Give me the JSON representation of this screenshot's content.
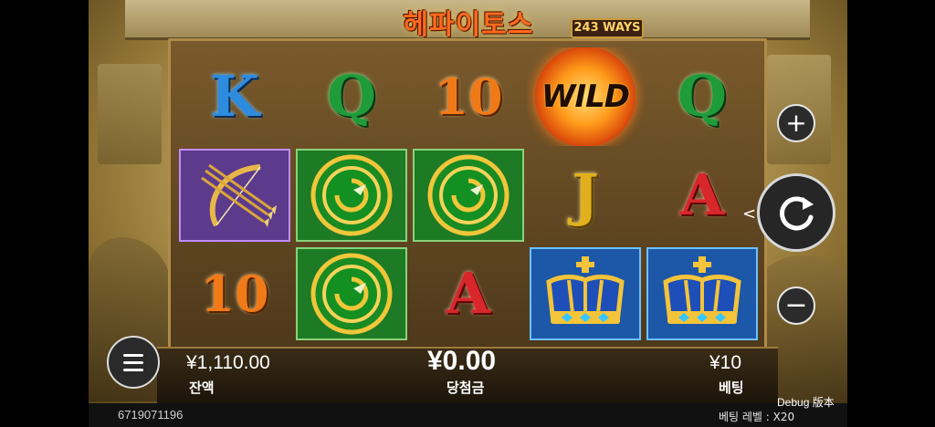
{
  "game": {
    "title": "헤파이토스",
    "ways_badge": "243 WAYS"
  },
  "reels": [
    [
      "K",
      "bow-arrows",
      "10"
    ],
    [
      "Q",
      "shield",
      "shield"
    ],
    [
      "10",
      "shield",
      "A"
    ],
    [
      "WILD",
      "J",
      "crown"
    ],
    [
      "Q",
      "A",
      "crown"
    ]
  ],
  "symbols": {
    "wild_text": "WILD",
    "K": "K",
    "Q": "Q",
    "J": "J",
    "A": "A",
    "ten": "10"
  },
  "hud": {
    "balance_value": "¥1,110.00",
    "balance_label": "잔액",
    "win_value": "¥0.00",
    "win_label": "당첨금",
    "bet_value": "¥10",
    "bet_label": "베팅",
    "plus": "+",
    "minus": "−",
    "spin_hint": "<"
  },
  "footer": {
    "session_id": "6719071196",
    "debug": "Debug 版本",
    "bet_level": "베팅 레벨 : X20"
  },
  "colors": {
    "card_k": "#2e8cde",
    "card_q": "#1f9b3a",
    "card_10": "#f17a18",
    "card_j": "#e2b01e",
    "card_a": "#d8262a",
    "tile_purple": "#5c3a8c",
    "tile_green": "#1d7a25",
    "tile_blue": "#1d57a8"
  }
}
